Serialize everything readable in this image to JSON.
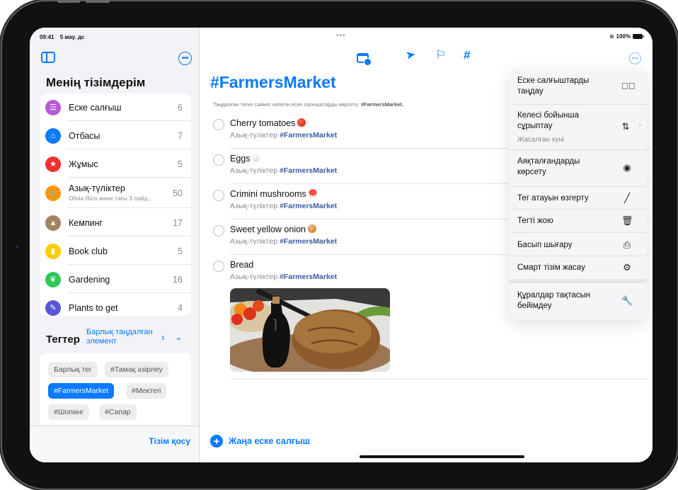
{
  "status_bar": {
    "time": "09:41",
    "date": "5 мау. дс",
    "battery": "100%"
  },
  "sidebar": {
    "title": "Менің тізімдерім",
    "lists": [
      {
        "name": "Еске салғыш",
        "count": "6",
        "color": "#b45bd6",
        "icon": "list-icon"
      },
      {
        "name": "Отбасы",
        "count": "7",
        "color": "#0a7aff",
        "icon": "house-icon"
      },
      {
        "name": "Жұмыс",
        "count": "5",
        "color": "#f0322e",
        "icon": "star-icon"
      },
      {
        "name": "Азық-түліктер",
        "subtitle": "Olivia Rico және тағы 3 пайд...",
        "count": "50",
        "color": "#ff9500",
        "icon": "cart-icon"
      },
      {
        "name": "Кемпинг",
        "count": "17",
        "color": "#a2845e",
        "icon": "tent-icon"
      },
      {
        "name": "Book club",
        "count": "5",
        "color": "#ffcc00",
        "icon": "bookmark-icon"
      },
      {
        "name": "Gardening",
        "count": "16",
        "color": "#30c759",
        "icon": "leaf-icon"
      },
      {
        "name": "Plants to get",
        "count": "4",
        "color": "#5856d6",
        "icon": "dropper-icon"
      }
    ],
    "tags_title": "Тегтер",
    "tags_filter": "Барлық таңдалған элемент",
    "tags": [
      {
        "label": "Барлық тег",
        "selected": false
      },
      {
        "label": "#Тамақ әзірлеу",
        "selected": false
      },
      {
        "label": "#FarmersMarket",
        "selected": true
      },
      {
        "label": "#Мектеп",
        "selected": false
      },
      {
        "label": "#Шопинг",
        "selected": false
      },
      {
        "label": "#Сапар",
        "selected": false
      }
    ],
    "add_list": "Тізім қосу"
  },
  "main": {
    "toolbar_icons": [
      "calendar-icon",
      "location-icon",
      "flag-icon",
      "hashtag-icon"
    ],
    "title": "#FarmersMarket",
    "caption_prefix": "Таңдалған тегке сәйкес келетін еске салғыштарды көрсету: ",
    "caption_tag": "#FarmersMarket.",
    "reminders": [
      {
        "title": "Cherry tomatoes",
        "emoji": "tomato",
        "list": "Азық-түліктер",
        "tag": "#FarmersMarket"
      },
      {
        "title": "Eggs",
        "emoji": "egg",
        "list": "Азық-түліктер",
        "tag": "#FarmersMarket"
      },
      {
        "title": "Crimini mushrooms",
        "emoji": "mushroom",
        "list": "Азық-түліктер",
        "tag": "#FarmersMarket"
      },
      {
        "title": "Sweet yellow onion",
        "emoji": "onion",
        "list": "Азық-түліктер",
        "tag": "#FarmersMarket"
      },
      {
        "title": "Bread",
        "emoji": "",
        "list": "Азық-түліктер",
        "tag": "#FarmersMarket",
        "has_photo": true
      }
    ],
    "new_reminder": "Жаңа еске салғыш"
  },
  "menu": {
    "items": [
      {
        "label": "Еске салғыштарды таңдау",
        "icon": "checkmark-circle-icon"
      },
      {
        "label": "Келесі бойынша сұрыптау",
        "sublabel": "Жасалған күні",
        "icon": "sort-arrows-icon",
        "has_submenu": true
      },
      {
        "label": "Аяқталғандарды көрсету",
        "icon": "eye-icon"
      },
      {
        "label": "Тег атауын өзгерту",
        "icon": "pencil-icon"
      },
      {
        "label": "Тегті жою",
        "icon": "trash-icon"
      },
      {
        "label": "Басып шығару",
        "icon": "printer-icon"
      },
      {
        "label": "Смарт тізім жасау",
        "icon": "gear-icon"
      },
      {
        "label": "Құралдар тақтасын бейімдеу",
        "icon": "wrench-icon"
      }
    ]
  }
}
